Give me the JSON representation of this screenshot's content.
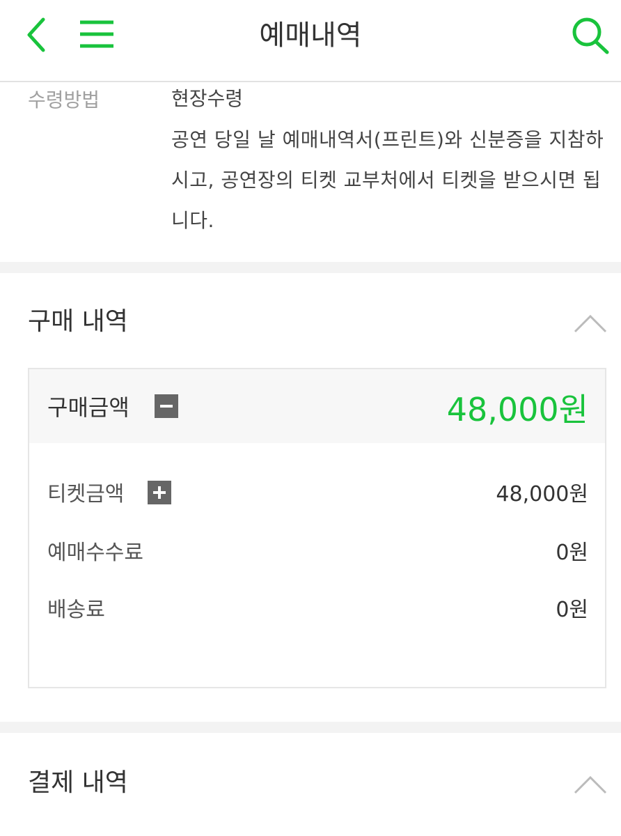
{
  "header": {
    "title": "예매내역",
    "back_icon": "chevron-left-icon",
    "menu_icon": "hamburger-menu-icon",
    "search_icon": "search-icon",
    "accent_color": "#19c33c"
  },
  "receive": {
    "label": "수령방법",
    "value": "현장수령",
    "description": "공연 당일 날 예매내역서(프린트)와 신분증을 지참하시고, 공연장의 티켓 교부처에서 티켓을 받으시면 됩니다."
  },
  "purchase": {
    "section_title": "구매 내역",
    "total_label": "구매금액",
    "total_amount": "48,000원",
    "rows": [
      {
        "label": "티켓금액",
        "value": "48,000원"
      },
      {
        "label": "예매수수료",
        "value": "0원"
      },
      {
        "label": "배송료",
        "value": "0원"
      }
    ]
  },
  "payment": {
    "section_title": "결제 내역"
  }
}
